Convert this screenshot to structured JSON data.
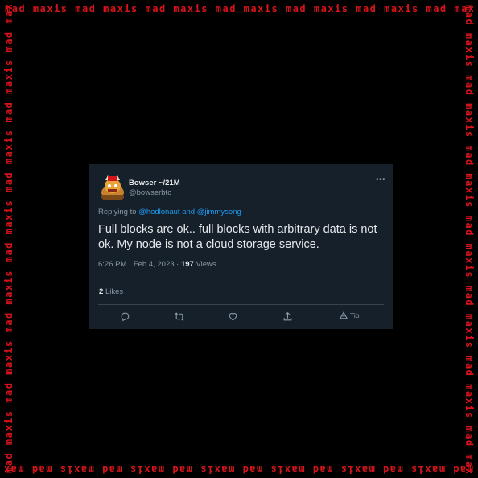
{
  "frame": {
    "text": "mad maxis mad maxis mad maxis mad maxis mad maxis mad maxis mad maxis",
    "color": "#d8141b"
  },
  "tweet": {
    "display_name": "Bowser ~/21M",
    "handle": "@bowserbtc",
    "more_icon": "more-horizontal-icon",
    "replying_prefix": "Replying to",
    "replying_to": "@hodlonaut and @jimmysong",
    "text": "Full blocks are ok.. full blocks with arbitrary data is not ok. My node is not a cloud storage service.",
    "time_date": "6:26 PM · Feb 4, 2023 ·",
    "view_count": "197",
    "views_label": "Views",
    "like_count": "2",
    "likes_label": "Likes",
    "actions": [
      "reply-icon",
      "retweet-icon",
      "like-icon",
      "share-icon",
      "tip-icon"
    ],
    "tip_label": "Tip",
    "colors": {
      "background": "#15202b",
      "text": "#e7e9ea",
      "muted": "#8b98a5",
      "link": "#1d9bf0",
      "divider": "#38444d"
    }
  }
}
